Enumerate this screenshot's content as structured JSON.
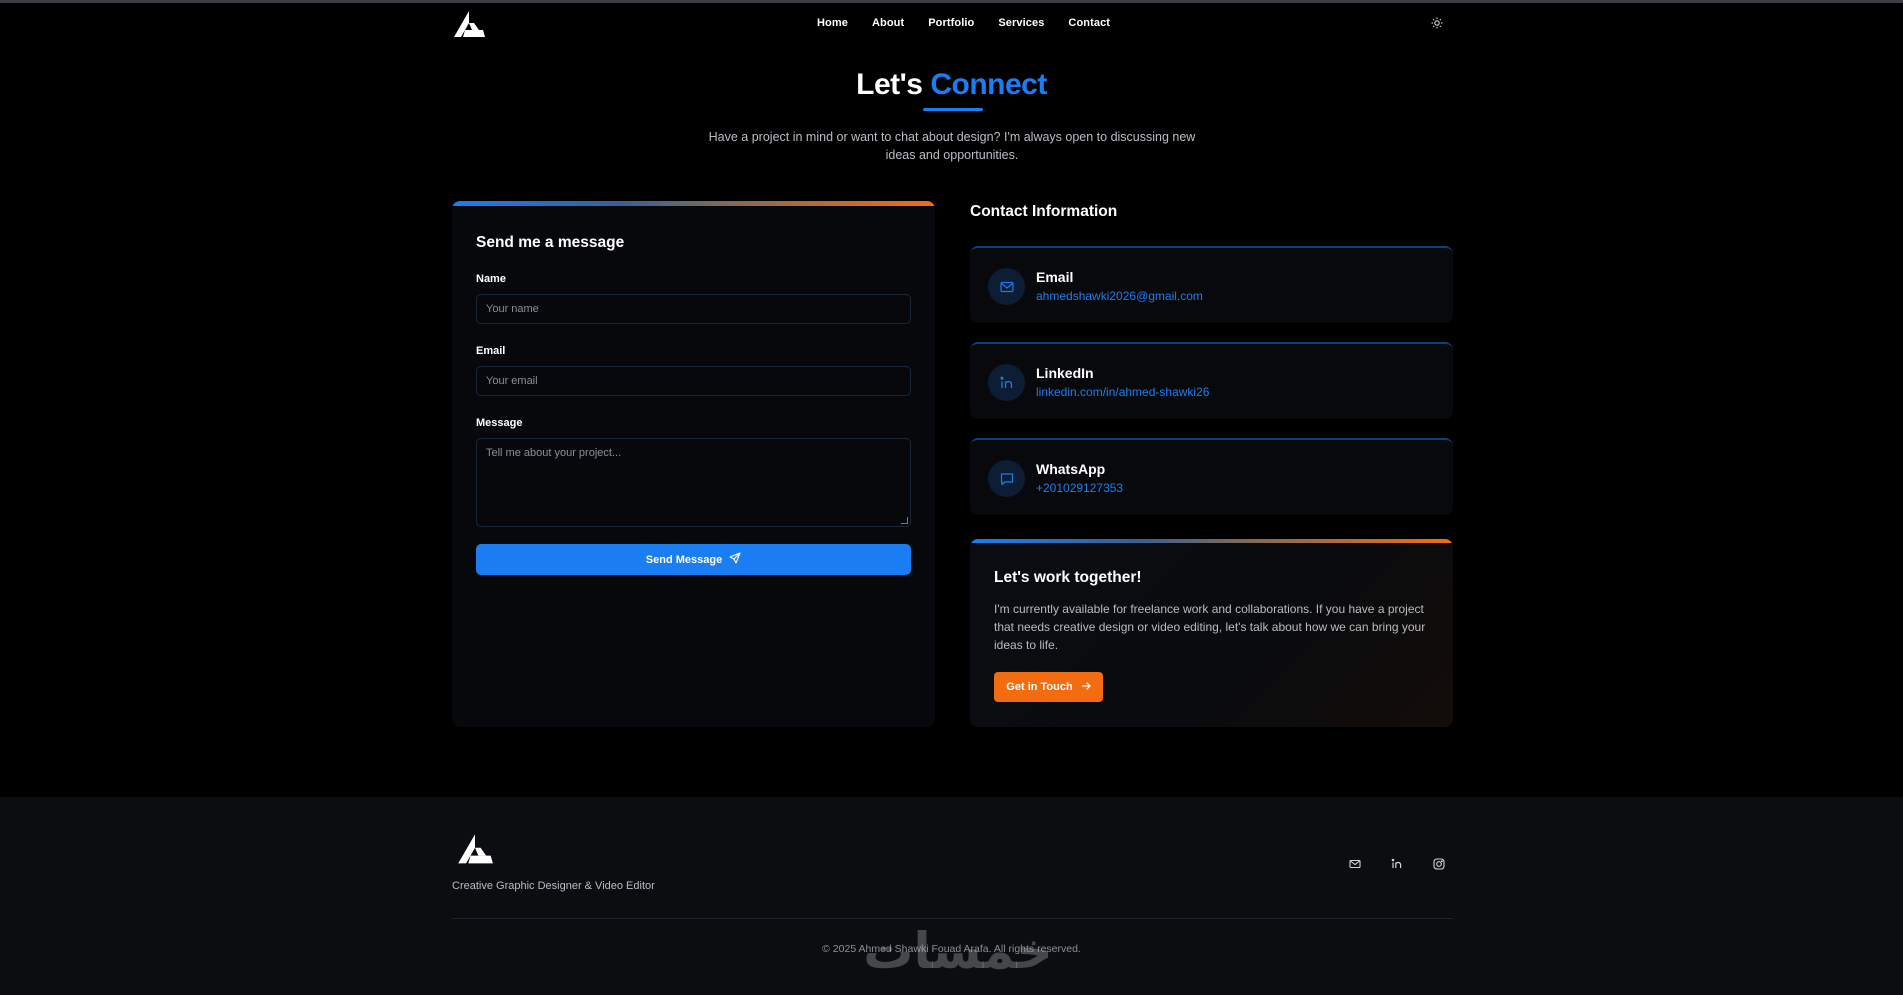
{
  "nav": {
    "links": [
      "Home",
      "About",
      "Portfolio",
      "Services",
      "Contact"
    ],
    "theme_icon": "sun-icon"
  },
  "hero": {
    "title_part1": "Let's",
    "title_part2": "Connect",
    "subtitle": "Have a project in mind or want to chat about design? I'm always open to discussing new ideas and opportunities."
  },
  "form": {
    "title": "Send me a message",
    "name_label": "Name",
    "name_placeholder": "Your name",
    "email_label": "Email",
    "email_placeholder": "Your email",
    "message_label": "Message",
    "message_placeholder": "Tell me about your project...",
    "submit_label": "Send Message",
    "submit_icon": "send-icon"
  },
  "contact_info": {
    "title": "Contact Information",
    "items": [
      {
        "label": "Email",
        "value": "ahmedshawki2026@gmail.com",
        "icon": "mail-icon"
      },
      {
        "label": "LinkedIn",
        "value": "linkedin.com/in/ahmed-shawki26",
        "icon": "linkedin-icon"
      },
      {
        "label": "WhatsApp",
        "value": "+201029127353",
        "icon": "message-icon"
      }
    ]
  },
  "work_together": {
    "title": "Let's work together!",
    "text": "I'm currently available for freelance work and collaborations. If you have a project that needs creative design or video editing, let's talk about how we can bring your ideas to life.",
    "button_label": "Get in Touch",
    "button_icon": "arrow-right-icon"
  },
  "footer": {
    "tagline": "Creative Graphic Designer & Video Editor",
    "socials": [
      "mail-icon",
      "linkedin-icon",
      "instagram-icon"
    ],
    "copyright": "© 2025 Ahmed Shawki Fouad Arafa. All rights reserved.",
    "watermark": "خمسات"
  },
  "colors": {
    "accent_blue": "#1a7df2",
    "accent_orange": "#f36d10",
    "background": "#000000"
  }
}
